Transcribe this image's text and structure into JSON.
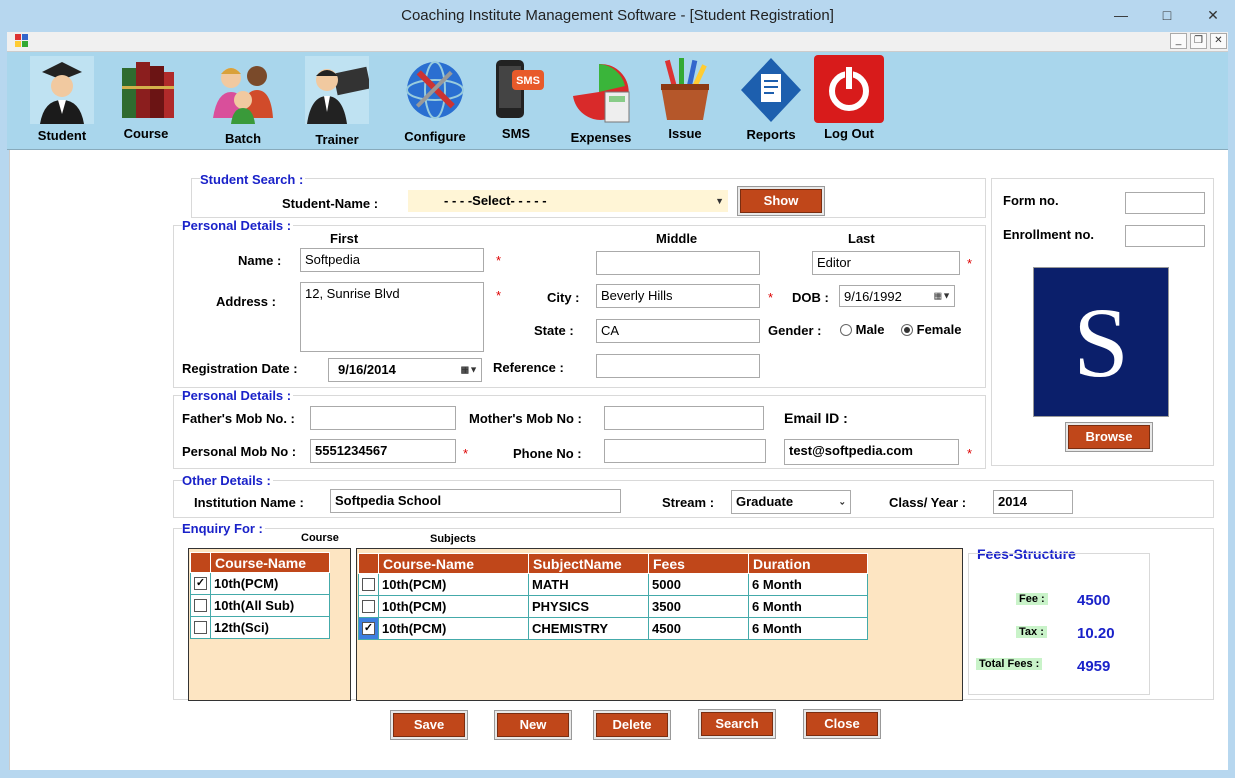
{
  "window": {
    "title": "Coaching Institute Management Software - [Student Registration]"
  },
  "toolbar": [
    {
      "label": "Student",
      "icon": "student-icon"
    },
    {
      "label": "Course",
      "icon": "books-icon"
    },
    {
      "label": "Batch",
      "icon": "group-icon"
    },
    {
      "label": "Trainer",
      "icon": "trainer-icon"
    },
    {
      "label": "Configure",
      "icon": "configure-icon"
    },
    {
      "label": "SMS",
      "icon": "sms-icon"
    },
    {
      "label": "Expenses",
      "icon": "expenses-icon"
    },
    {
      "label": "Issue",
      "icon": "issue-icon"
    },
    {
      "label": "Reports",
      "icon": "reports-icon"
    },
    {
      "label": "Log Out",
      "icon": "power-icon"
    }
  ],
  "search": {
    "title": "Student Search :",
    "label": "Student-Name :",
    "value": "- - - -Select- - - - -",
    "show": "Show"
  },
  "side": {
    "form_label": "Form no.",
    "form_value": "",
    "enroll_label": "Enrollment no.",
    "enroll_value": "",
    "photo_letter": "S",
    "browse": "Browse"
  },
  "personal": {
    "title": "Personal Details :",
    "col_first": "First",
    "col_middle": "Middle",
    "col_last": "Last",
    "name_label": "Name :",
    "first": "Softpedia",
    "middle": "",
    "last": "Editor",
    "address_label": "Address :",
    "address": "12, Sunrise Blvd",
    "city_label": "City :",
    "city": "Beverly Hills",
    "dob_label": "DOB :",
    "dob": "9/16/1992",
    "state_label": "State :",
    "state": "CA",
    "gender_label": "Gender :",
    "male": "Male",
    "female": "Female",
    "gender": "Female",
    "reg_label": "Registration Date :",
    "reg_date": "9/16/2014",
    "ref_label": "Reference :",
    "reference": "",
    "star": "*"
  },
  "contact": {
    "title": "Personal Details :",
    "father_label": "Father's Mob No. :",
    "father": "",
    "mother_label": "Mother's Mob No :",
    "mother": "",
    "email_label": "Email ID :",
    "email": "test@softpedia.com",
    "personal_label": "Personal Mob No :",
    "personal": "5551234567",
    "phone_label": "Phone No :",
    "phone": ""
  },
  "other": {
    "title": "Other Details :",
    "inst_label": "Institution Name :",
    "institution": "Softpedia School",
    "stream_label": "Stream :",
    "stream": "Graduate",
    "class_label": "Class/ Year :",
    "class_year": "2014"
  },
  "enquiry": {
    "title": "Enquiry For :",
    "course_caption": "Course",
    "subjects_caption": "Subjects",
    "course_header": "Course-Name",
    "courses": [
      {
        "name": "10th(PCM)",
        "checked": true
      },
      {
        "name": "10th(All Sub)",
        "checked": false
      },
      {
        "name": "12th(Sci)",
        "checked": false
      }
    ],
    "subject_headers": [
      "Course-Name",
      "SubjectName",
      "Fees",
      "Duration"
    ],
    "subjects": [
      {
        "course": "10th(PCM)",
        "subject": "MATH",
        "fees": "5000",
        "duration": "6 Month",
        "checked": false
      },
      {
        "course": "10th(PCM)",
        "subject": "PHYSICS",
        "fees": "3500",
        "duration": "6 Month",
        "checked": false
      },
      {
        "course": "10th(PCM)",
        "subject": "CHEMISTRY",
        "fees": "4500",
        "duration": "6 Month",
        "checked": true
      }
    ]
  },
  "fees": {
    "title": "Fees-Structure",
    "fee_label": "Fee :",
    "fee": "4500",
    "tax_label": "Tax :",
    "tax": "10.20",
    "total_label": "Total Fees :",
    "total": "4959"
  },
  "actions": {
    "save": "Save",
    "new": "New",
    "delete": "Delete",
    "search": "Search",
    "close": "Close"
  },
  "colors": {
    "accent": "#c0471a",
    "title_blue": "#1a22c9",
    "toolbar": "#a9d6ec"
  }
}
